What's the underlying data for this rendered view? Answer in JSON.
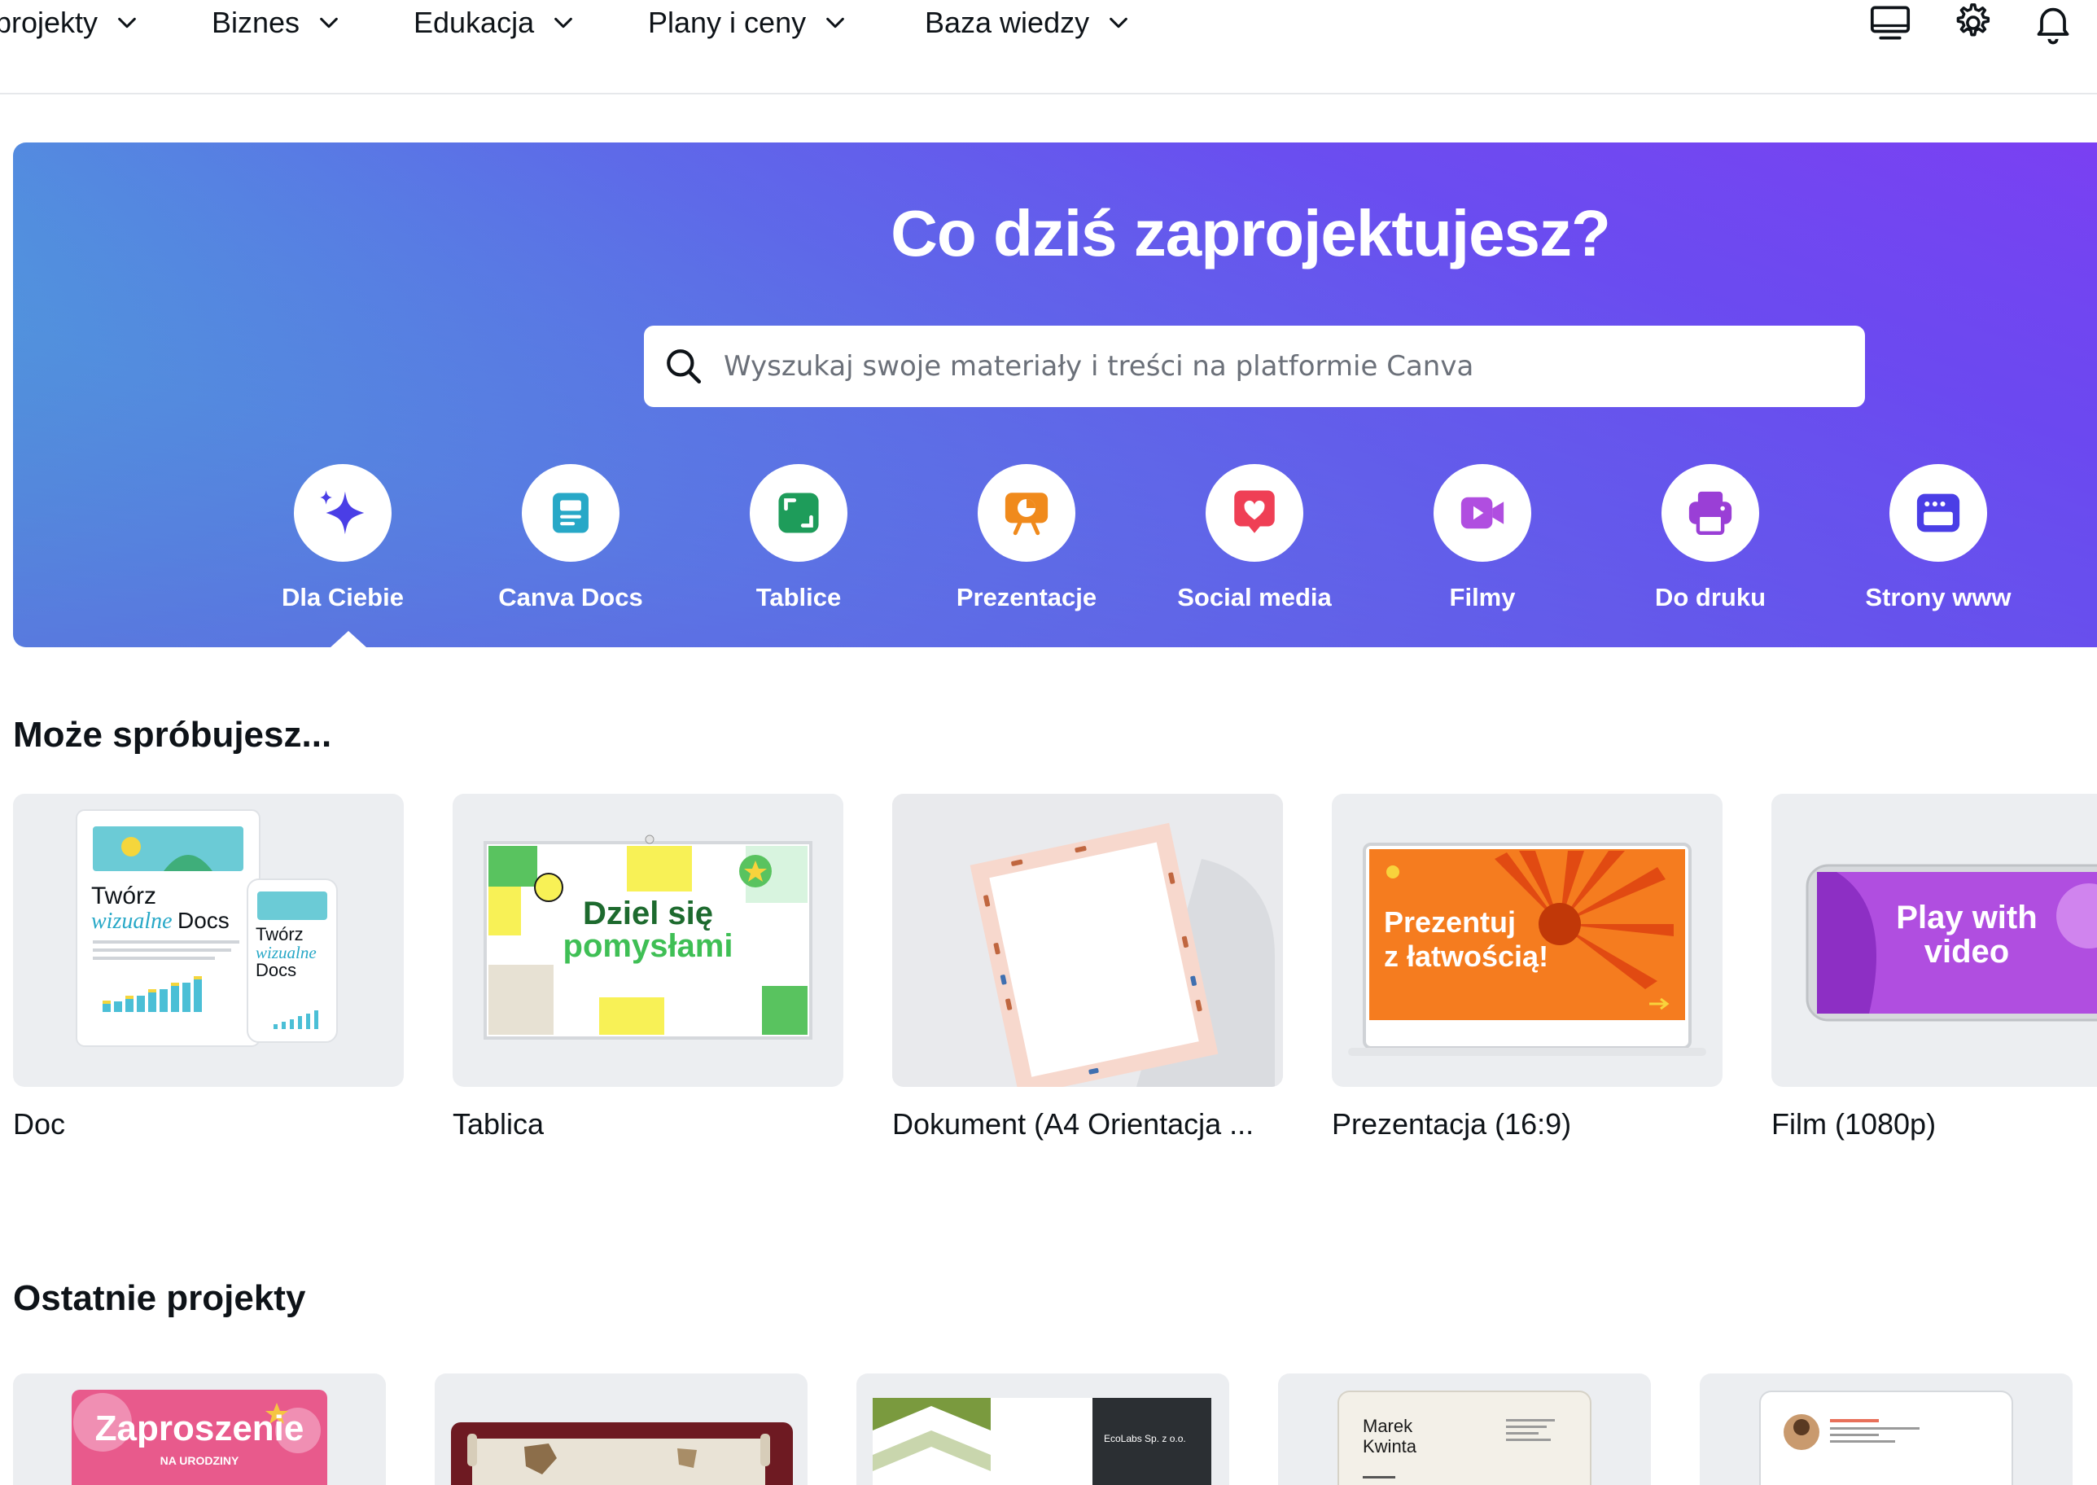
{
  "nav": {
    "items": [
      {
        "label": "projekty"
      },
      {
        "label": "Biznes"
      },
      {
        "label": "Edukacja"
      },
      {
        "label": "Plany i ceny"
      },
      {
        "label": "Baza wiedzy"
      }
    ],
    "icons": [
      "desktop-icon",
      "gear-icon",
      "bell-icon"
    ]
  },
  "hero": {
    "title": "Co dziś zaprojektujesz?",
    "search_placeholder": "Wyszukaj swoje materiały i treści na platformie Canva",
    "categories": [
      {
        "label": "Dla Ciebie",
        "icon": "sparkle-icon",
        "color": "#4a3ee6"
      },
      {
        "label": "Canva Docs",
        "icon": "doc-icon",
        "color": "#27a8c7"
      },
      {
        "label": "Tablice",
        "icon": "whiteboard-icon",
        "color": "#1e9c5a"
      },
      {
        "label": "Prezentacje",
        "icon": "presentation-icon",
        "color": "#f08a1c"
      },
      {
        "label": "Social media",
        "icon": "heart-icon",
        "color": "#ef3f55"
      },
      {
        "label": "Filmy",
        "icon": "video-icon",
        "color": "#b04ee0"
      },
      {
        "label": "Do druku",
        "icon": "printer-icon",
        "color": "#9a3fd6"
      },
      {
        "label": "Strony www",
        "icon": "website-icon",
        "color": "#4a3ee6"
      }
    ],
    "selected": "Dla Ciebie"
  },
  "suggest": {
    "title": "Może spróbujesz...",
    "cards": [
      {
        "label": "Doc",
        "thumb_text_1": "Twórz",
        "thumb_text_2": "wizualne",
        "thumb_text_3": "Docs",
        "thumb_text_4": "Twórz",
        "thumb_text_5": "wizualne",
        "thumb_text_6": "Docs"
      },
      {
        "label": "Tablica",
        "thumb_text_1": "Dziel się",
        "thumb_text_2": "pomysłami"
      },
      {
        "label": "Dokument (A4 Orientacja ..."
      },
      {
        "label": "Prezentacja (16:9)",
        "thumb_text_1": "Prezentuj",
        "thumb_text_2": "z łatwością!"
      },
      {
        "label": "Film (1080p)",
        "thumb_text_1": "Play with",
        "thumb_text_2": "video"
      }
    ]
  },
  "recent": {
    "title": "Ostatnie projekty",
    "cards": [
      {
        "thumb_text_1": "Zaproszenie",
        "thumb_text_2": "NA URODZINY"
      },
      {},
      {
        "thumb_text_1": "EcoLabs Sp. z o.o."
      },
      {
        "thumb_text_1": "Marek",
        "thumb_text_2": "Kwinta"
      },
      {}
    ]
  }
}
